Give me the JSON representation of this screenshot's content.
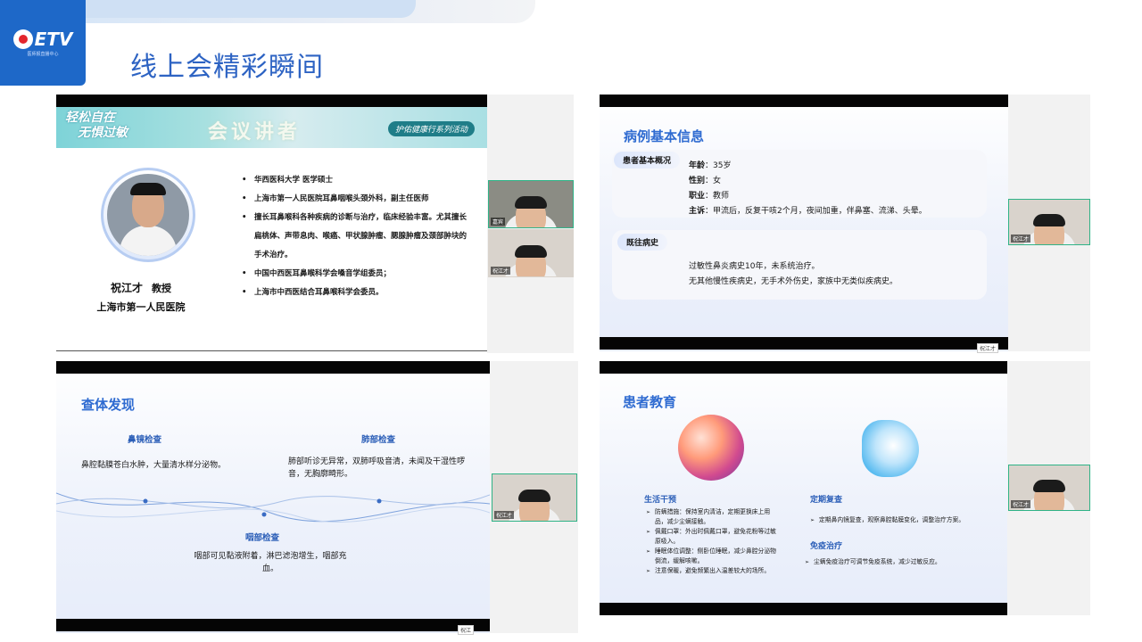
{
  "header": {
    "logo_text": "ETV",
    "logo_sub": "医师报直播中心",
    "title": "线上会精彩瞬间"
  },
  "slide1": {
    "brand_line1": "轻松自在",
    "brand_line2": "无惧过敏",
    "banner_title": "会议讲者",
    "pill": "护佑健康行系列活动",
    "speaker_name": "祝江才",
    "speaker_title": "教授",
    "speaker_org": "上海市第一人民医院",
    "bullets": [
      "华西医科大学 医学硕士",
      "上海市第一人民医院耳鼻咽喉头颈外科，副主任医师",
      "擅长耳鼻喉科各种疾病的诊断与治疗，临床经验丰富。尤其擅长扁桃体、声带息肉、喉癌、甲状腺肿瘤、腮腺肿瘤及颈部肿块的手术治疗。",
      "中国中西医耳鼻喉科学会嗓音学组委员；",
      "上海市中西医结合耳鼻喉科学会委员。"
    ],
    "cam1_tag": "嘉宾",
    "cam2_tag": "祝江才"
  },
  "slide2": {
    "title": "病例基本信息",
    "card1_label": "患者基本概况",
    "age_label": "年龄",
    "age_value": "：35岁",
    "sex_label": "性别",
    "sex_value": "：女",
    "job_label": "职业",
    "job_value": "：教师",
    "complaint_label": "主诉",
    "complaint_value": "：甲流后，反复干咳2个月，夜间加重，伴鼻塞、流涕、头晕。",
    "card2_label": "既往病史",
    "history1": "过敏性鼻炎病史10年，未系统治疗。",
    "history2": "无其他慢性疾病史，无手术外伤史，家族中无类似疾病史。",
    "cam_tag": "祝江才",
    "toolbar": "祝江才"
  },
  "slide3": {
    "title": "查体发现",
    "sub1": "鼻镜检查",
    "text1": "鼻腔黏膜苍白水肿，大量清水样分泌物。",
    "sub2": "肺部检查",
    "text2": "肺部听诊无异常，双肺呼吸音清，未闻及干湿性啰音，无胸廓畸形。",
    "sub3": "咽部检查",
    "text3": "咽部可见黏液附着，淋巴滤泡增生，咽部充血。",
    "cam_tag": "祝江才",
    "toolbar": "祝江"
  },
  "slide4": {
    "title": "患者教育",
    "sub_life": "生活干预",
    "life_items": [
      "防螨措施：保持室内清洁，定期更换床上用品，减少尘螨接触。",
      "佩戴口罩：外出时佩戴口罩，避免花粉等过敏原吸入。",
      "睡眠体位调整：侧卧位睡眠，减少鼻腔分泌物倒流，缓解咳嗽。",
      "注意保暖，避免频繁出入温差较大的场所。"
    ],
    "sub_review": "定期复查",
    "review_items": [
      "定期鼻内镜复查，观察鼻腔黏膜变化，调整治疗方案。"
    ],
    "sub_immune": "免疫治疗",
    "immune_items": [
      "尘螨免疫治疗可调节免疫系统，减少过敏反应。"
    ],
    "cam_tag": "祝江才"
  }
}
